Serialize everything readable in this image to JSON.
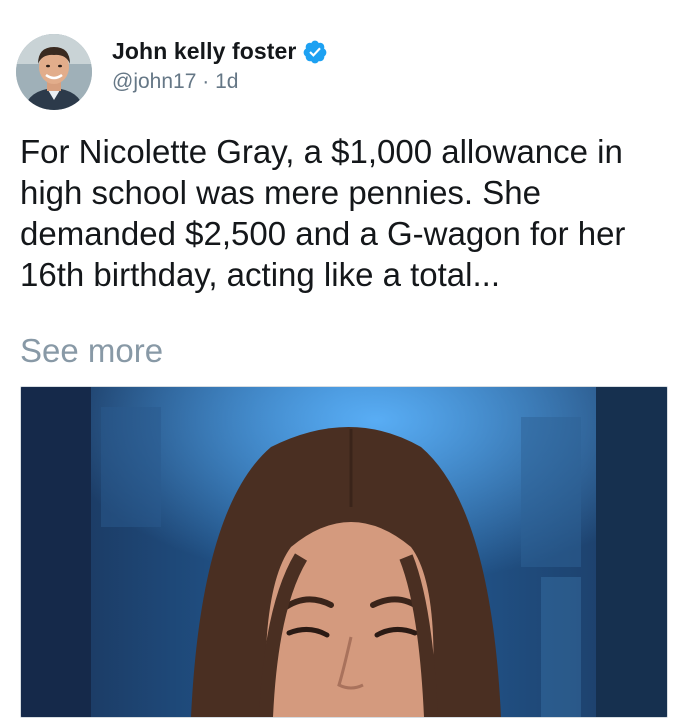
{
  "author": {
    "display_name": "John kelly foster",
    "handle": "@john17",
    "separator": "·",
    "time": "1d",
    "verified_icon": "verified-badge-icon"
  },
  "tweet": {
    "text": "For Nicolette Gray, a $1,000 allowance in high school was mere pennies. She demanded $2,500 and a G-wagon for her 16th birthday, acting like a total...",
    "see_more": "See more"
  },
  "colors": {
    "verified": "#1da1f2",
    "secondary_text": "#657786",
    "see_more": "#8899a6"
  }
}
